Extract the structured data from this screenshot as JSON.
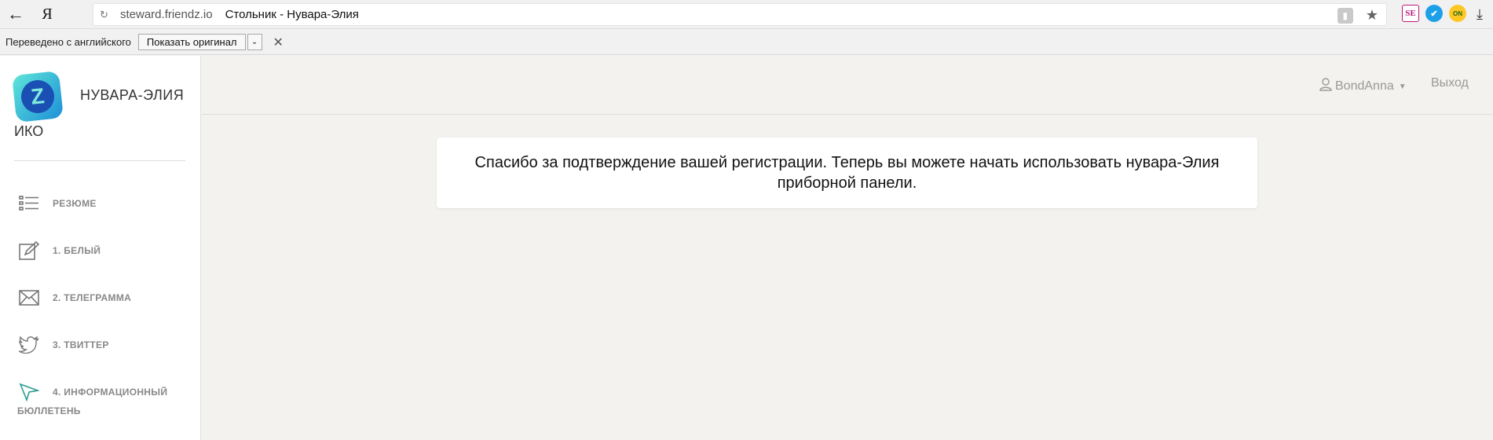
{
  "browser": {
    "back_icon": "arrow-left-icon",
    "ya_logo": "Я",
    "url_domain": "steward.friendz.io",
    "page_title": "Стольник - Нувара-Элия"
  },
  "translate_bar": {
    "text": "Переведено с английского",
    "show_original": "Показать оригинал"
  },
  "sidebar": {
    "brand_line1": "НУВАРА-ЭЛИЯ",
    "brand_line2": "ИКО",
    "items": [
      {
        "label": "РЕЗЮМЕ",
        "icon": "list-icon"
      },
      {
        "label": "1. БЕЛЫЙ",
        "icon": "edit-icon"
      },
      {
        "label": "2. ТЕЛЕГРАММА",
        "icon": "envelope-icon"
      },
      {
        "label": "3. ТВИТТЕР",
        "icon": "twitter-icon"
      },
      {
        "label": "4. ИНФОРМАЦИОННЫЙ",
        "label2": "БЮЛЛЕТЕНЬ",
        "icon": "send-icon"
      }
    ]
  },
  "header": {
    "username": "BondAnna",
    "logout": "Выход"
  },
  "main": {
    "message_line1": "Спасибо за подтверждение вашей регистрации. Теперь вы можете начать использовать нувара-Элия",
    "message_line2": "приборной панели."
  },
  "colors": {
    "page_bg": "#f3f2ef",
    "sidebar_bg": "#ffffff",
    "menu_text": "#888888",
    "accent_icon": "#2a9d8f"
  }
}
